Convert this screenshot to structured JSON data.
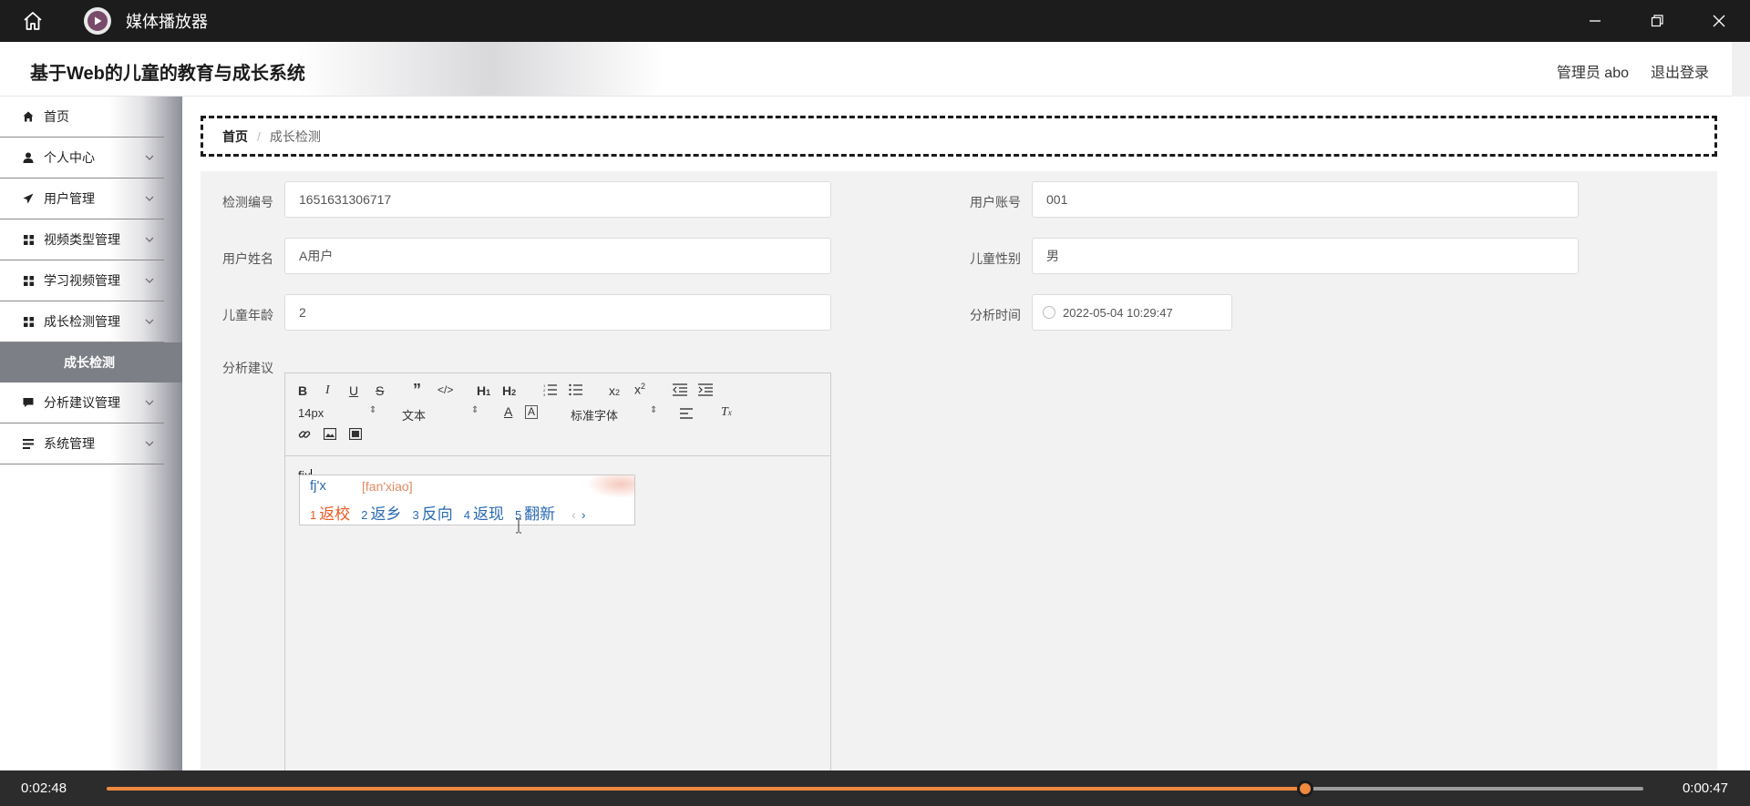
{
  "window": {
    "title": "媒体播放器",
    "icons": {
      "home": "home-icon",
      "logo": "media-player-logo",
      "minimize": "minimize-icon",
      "restore": "restore-icon",
      "close": "close-icon"
    }
  },
  "header": {
    "app_title": "基于Web的儿童的教育与成长系统",
    "admin_label": "管理员 abo",
    "logout_label": "退出登录"
  },
  "sidebar": {
    "items": [
      {
        "label": "首页",
        "icon": "home-icon"
      },
      {
        "label": "个人中心",
        "icon": "user-icon"
      },
      {
        "label": "用户管理",
        "icon": "paper-plane-icon"
      },
      {
        "label": "视频类型管理",
        "icon": "grid-icon"
      },
      {
        "label": "学习视频管理",
        "icon": "grid-icon"
      },
      {
        "label": "成长检测管理",
        "icon": "grid-icon"
      },
      {
        "label": "分析建议管理",
        "icon": "chat-icon"
      },
      {
        "label": "系统管理",
        "icon": "list-icon"
      }
    ],
    "active_sub": "成长检测"
  },
  "breadcrumb": {
    "home": "首页",
    "separator": "/",
    "current": "成长检测"
  },
  "form": {
    "check_id": {
      "label": "检测编号",
      "value": "1651631306717"
    },
    "user_account": {
      "label": "用户账号",
      "value": "001"
    },
    "user_name": {
      "label": "用户姓名",
      "value": "A用户"
    },
    "child_gender": {
      "label": "儿童性别",
      "value": "男"
    },
    "child_age": {
      "label": "儿童年龄",
      "value": "2"
    },
    "analysis_time": {
      "label": "分析时间",
      "value": "2022-05-04 10:29:47"
    },
    "advice": {
      "label": "分析建议"
    }
  },
  "editor": {
    "font_size": "14px",
    "header_select": "文本",
    "font_family": "标准字体",
    "content": "fjx"
  },
  "ime": {
    "pinyin": "fj'x",
    "full_pinyin": "[fan'xiao]",
    "candidates": [
      {
        "num": "1",
        "text": "返校"
      },
      {
        "num": "2",
        "text": "返乡"
      },
      {
        "num": "3",
        "text": "反向"
      },
      {
        "num": "4",
        "text": "返现"
      },
      {
        "num": "5",
        "text": "翻新"
      }
    ],
    "prev": "‹",
    "next": "›"
  },
  "player": {
    "elapsed": "0:02:48",
    "remaining": "0:00:47",
    "progress_percent": 78,
    "accent": "#f0883e"
  }
}
